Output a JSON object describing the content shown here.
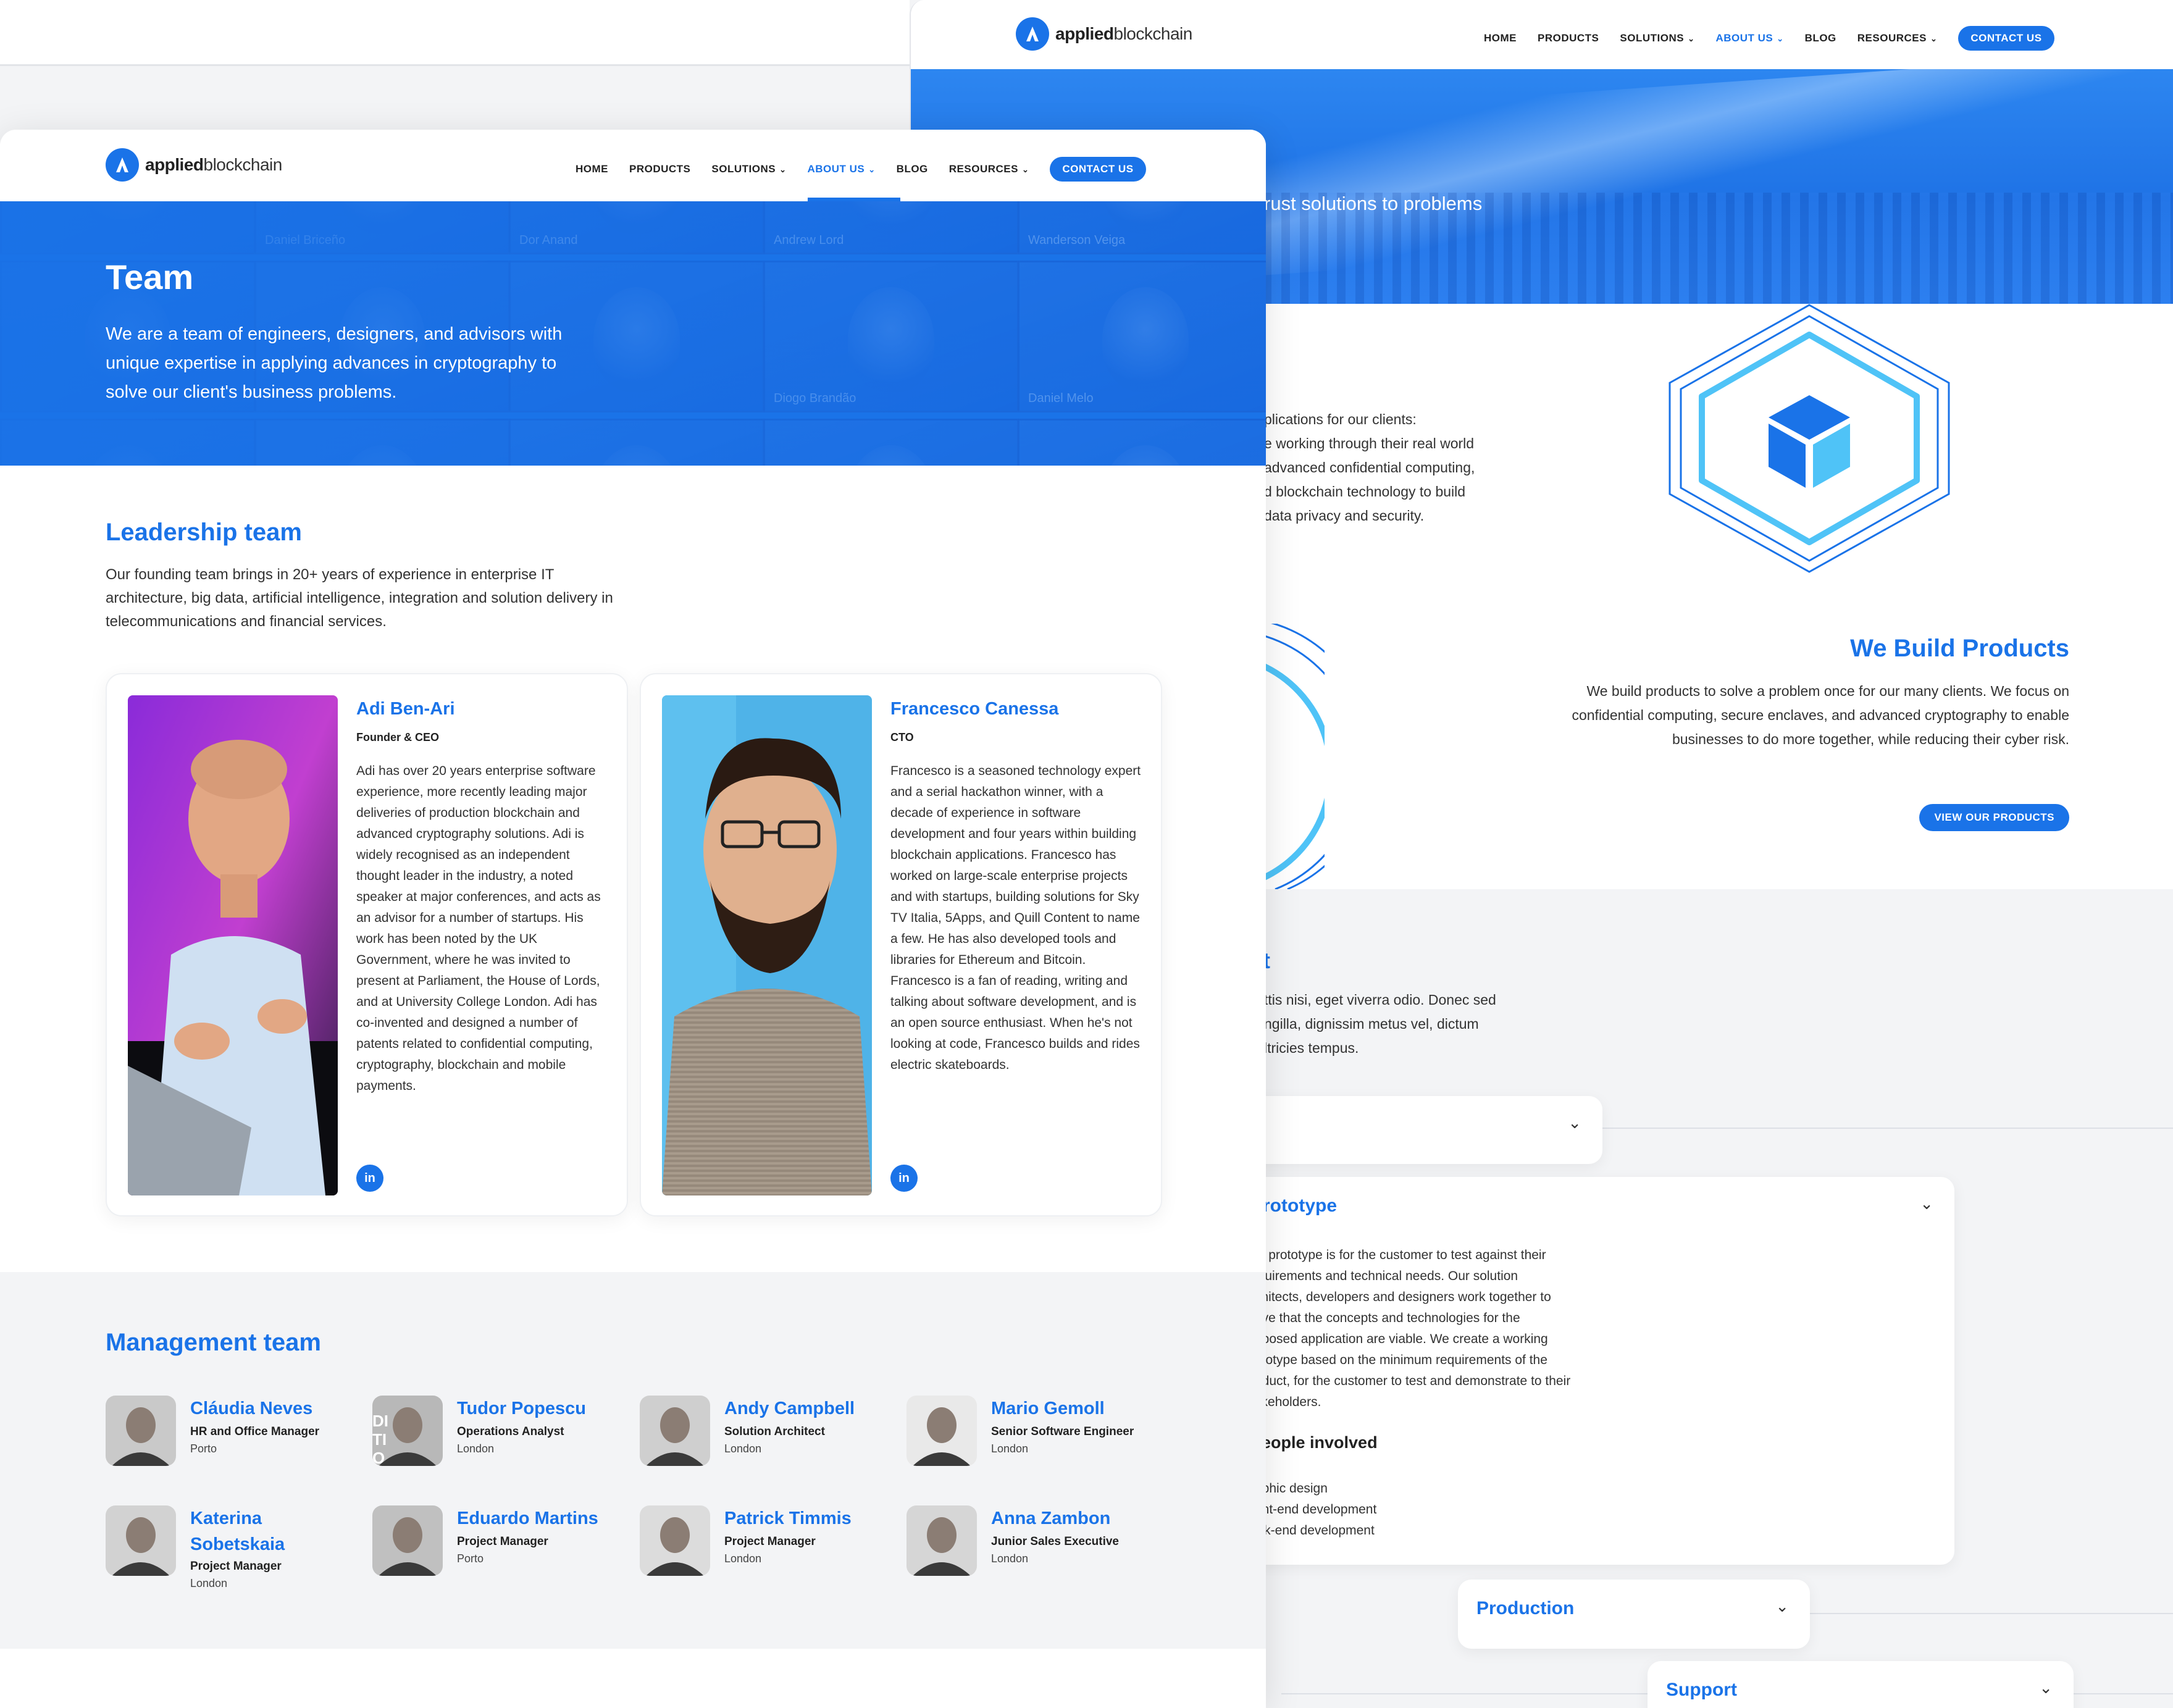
{
  "brand": {
    "logo_bold": "applied",
    "logo_light": "blockchain",
    "accent": "#1a73e8",
    "accent_light": "#4fc3f7"
  },
  "nav": {
    "items": [
      {
        "label": "HOME",
        "dropdown": false,
        "active": false
      },
      {
        "label": "PRODUCTS",
        "dropdown": false,
        "active": false
      },
      {
        "label": "SOLUTIONS",
        "dropdown": true,
        "active": false
      },
      {
        "label": "ABOUT US",
        "dropdown": true,
        "active": true
      },
      {
        "label": "BLOG",
        "dropdown": false,
        "active": false
      },
      {
        "label": "RESOURCES",
        "dropdown": true,
        "active": false
      }
    ],
    "cta": "CONTACT US"
  },
  "back": {
    "hero_text": "rust solutions to problems",
    "intro_lines": [
      "plications for our clients:",
      "e working through their real world",
      "advanced confidential computing,",
      "d blockchain technology to build",
      "data privacy and security."
    ],
    "products_title": "We Build Products",
    "products_body": "We build products to solve a problem once for our many clients. We focus on confidential computing, secure enclaves, and advanced cryptography to enable businesses to do more together, while reducing their cyber risk.",
    "products_button": "VIEW OUR PRODUCTS",
    "grey_title": "t",
    "grey_lines": [
      "ttis nisi, eget viverra odio. Donec sed",
      "ngilla, dignissim metus vel, dictum",
      "ltricies tempus."
    ],
    "accordions": [
      {
        "title": "",
        "expanded": false
      },
      {
        "title": "Prototype",
        "expanded": true,
        "body_lines": [
          "he prototype is for the customer to test against their",
          "equirements and technical needs. Our solution",
          "rchitects, developers and designers work together to",
          "rove that the concepts and technologies for the",
          "roposed application are viable. We create a working",
          "rototype based on the minimum requirements of the",
          "roduct, for the customer to test and demonstrate to their",
          "takeholders."
        ],
        "people_title": "People involved",
        "people": [
          "raphic design",
          "ront-end development",
          "ack-end development"
        ]
      },
      {
        "title": "Production",
        "expanded": false
      },
      {
        "title": "Support",
        "expanded": false
      }
    ]
  },
  "front": {
    "hero_title": "Team",
    "hero_sub": "We are a team of engineers, designers, and advisors with unique expertise in applying advances in cryptography to solve our client's business problems.",
    "tile_labels": [
      "Daniel Briceño",
      "Dor Anand",
      "Andrew Lord",
      "Wanderson Veiga",
      "",
      "",
      "Diogo Brandão",
      "Daniel Melo"
    ],
    "leadership_title": "Leadership team",
    "leadership_body": "Our founding team brings in 20+ years of experience in enterprise IT architecture, big data, artificial intelligence, integration and solution delivery in telecommunications and financial services.",
    "leaders": [
      {
        "name": "Adi Ben-Ari",
        "role": "Founder & CEO",
        "bio": "Adi has over 20 years enterprise software experience, more recently leading major deliveries of production blockchain and advanced cryptography solutions. Adi is widely recognised as an independent thought leader in the industry, a noted speaker at major conferences, and acts as an advisor for a number of startups. His work has been noted by the UK Government, where he was invited to present at Parliament, the House of Lords, and at University College London. Adi has co-invented and designed a number of patents related to confidential computing, cryptography, blockchain and mobile payments.",
        "social": "in"
      },
      {
        "name": "Francesco Canessa",
        "role": "CTO",
        "bio": "Francesco is a seasoned technology expert and a serial hackathon winner, with a decade of experience in software development and four years within building blockchain applications. Francesco has worked on large-scale enterprise projects and with startups, building solutions for Sky TV Italia, 5Apps, and Quill Content to name a few. He has also developed tools and libraries for Ethereum and Bitcoin. Francesco is a fan of reading, writing and talking about software development, and is an open source enthusiast. When he's not looking at code, Francesco builds and rides electric skateboards.",
        "social": "in"
      }
    ],
    "management_title": "Management team",
    "management": [
      {
        "name": "Cláudia Neves",
        "role": "HR and Office Manager",
        "location": "Porto"
      },
      {
        "name": "Tudor Popescu",
        "role": "Operations Analyst",
        "location": "London"
      },
      {
        "name": "Andy Campbell",
        "role": "Solution Architect",
        "location": "London"
      },
      {
        "name": "Mario Gemoll",
        "role": "Senior Software Engineer",
        "location": "London"
      },
      {
        "name": "Katerina Sobetskaia",
        "role": "Project Manager",
        "location": "London"
      },
      {
        "name": "Eduardo Martins",
        "role": "Project Manager",
        "location": "Porto"
      },
      {
        "name": "Patrick Timmis",
        "role": "Project Manager",
        "location": "London"
      },
      {
        "name": "Anna Zambon",
        "role": "Junior Sales Executive",
        "location": "London"
      }
    ],
    "avatar_tile_text": "DI TIO"
  }
}
